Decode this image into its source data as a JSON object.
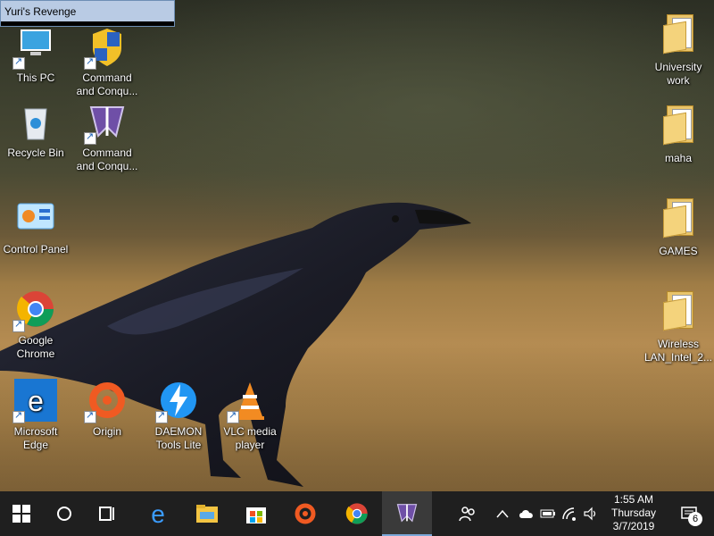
{
  "window_tooltip": {
    "title": "Yuri's Revenge"
  },
  "desktop_icons": [
    {
      "label_line1": "This PC",
      "label_line2": ""
    },
    {
      "label_line1": "Command",
      "label_line2": "and Conqu..."
    },
    {
      "label_line1": "University",
      "label_line2": "work"
    },
    {
      "label_line1": "Recycle Bin",
      "label_line2": ""
    },
    {
      "label_line1": "Command",
      "label_line2": "and Conqu..."
    },
    {
      "label_line1": "maha",
      "label_line2": ""
    },
    {
      "label_line1": "Control Panel",
      "label_line2": ""
    },
    {
      "label_line1": "GAMES",
      "label_line2": ""
    },
    {
      "label_line1": "Google",
      "label_line2": "Chrome"
    },
    {
      "label_line1": "Wireless",
      "label_line2": "LAN_Intel_2..."
    },
    {
      "label_line1": "Microsoft",
      "label_line2": "Edge"
    },
    {
      "label_line1": "Origin",
      "label_line2": ""
    },
    {
      "label_line1": "DAEMON",
      "label_line2": "Tools Lite"
    },
    {
      "label_line1": "VLC media",
      "label_line2": "player"
    }
  ],
  "taskbar": {
    "pinned": [
      "start-icon",
      "search-icon",
      "task-view-icon",
      "edge-icon",
      "file-explorer-icon",
      "store-icon",
      "origin-icon",
      "chrome-icon",
      "yuri-icon"
    ],
    "clock": {
      "time": "1:55 AM",
      "day": "Thursday",
      "date": "3/7/2019"
    },
    "notifications": {
      "count": "6"
    }
  },
  "colors": {
    "taskbar": "#1f1f1f",
    "accent": "#7aa7d8"
  }
}
